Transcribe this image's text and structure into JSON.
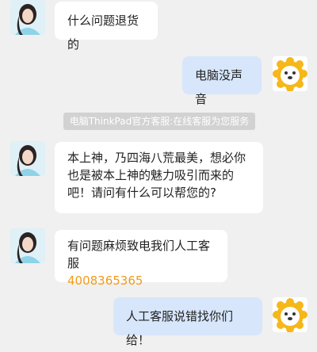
{
  "chat": {
    "messages": [
      {
        "sender": "user",
        "text": "什么问题退货的"
      },
      {
        "sender": "bot",
        "text": "电脑没声音"
      },
      {
        "sender": "user",
        "text": "本上神，乃四海八荒最美，想必你也是被本上神的魅力吸引而来的吧！请问有什么可以帮您的?"
      },
      {
        "sender": "user",
        "text": "有问题麻烦致电我们人工客服",
        "phone": "4008365365"
      },
      {
        "sender": "bot",
        "text": "人工客服说错找你们给！"
      }
    ],
    "system_notice": "电脑ThinkPad官方客服:在线客服为您服务"
  },
  "colors": {
    "background": "#f0f0f0",
    "bubble_white": "#ffffff",
    "bubble_blue": "#d7e6fb",
    "phone_link": "#f29b16",
    "notice_bg": "#d2d2d2"
  }
}
